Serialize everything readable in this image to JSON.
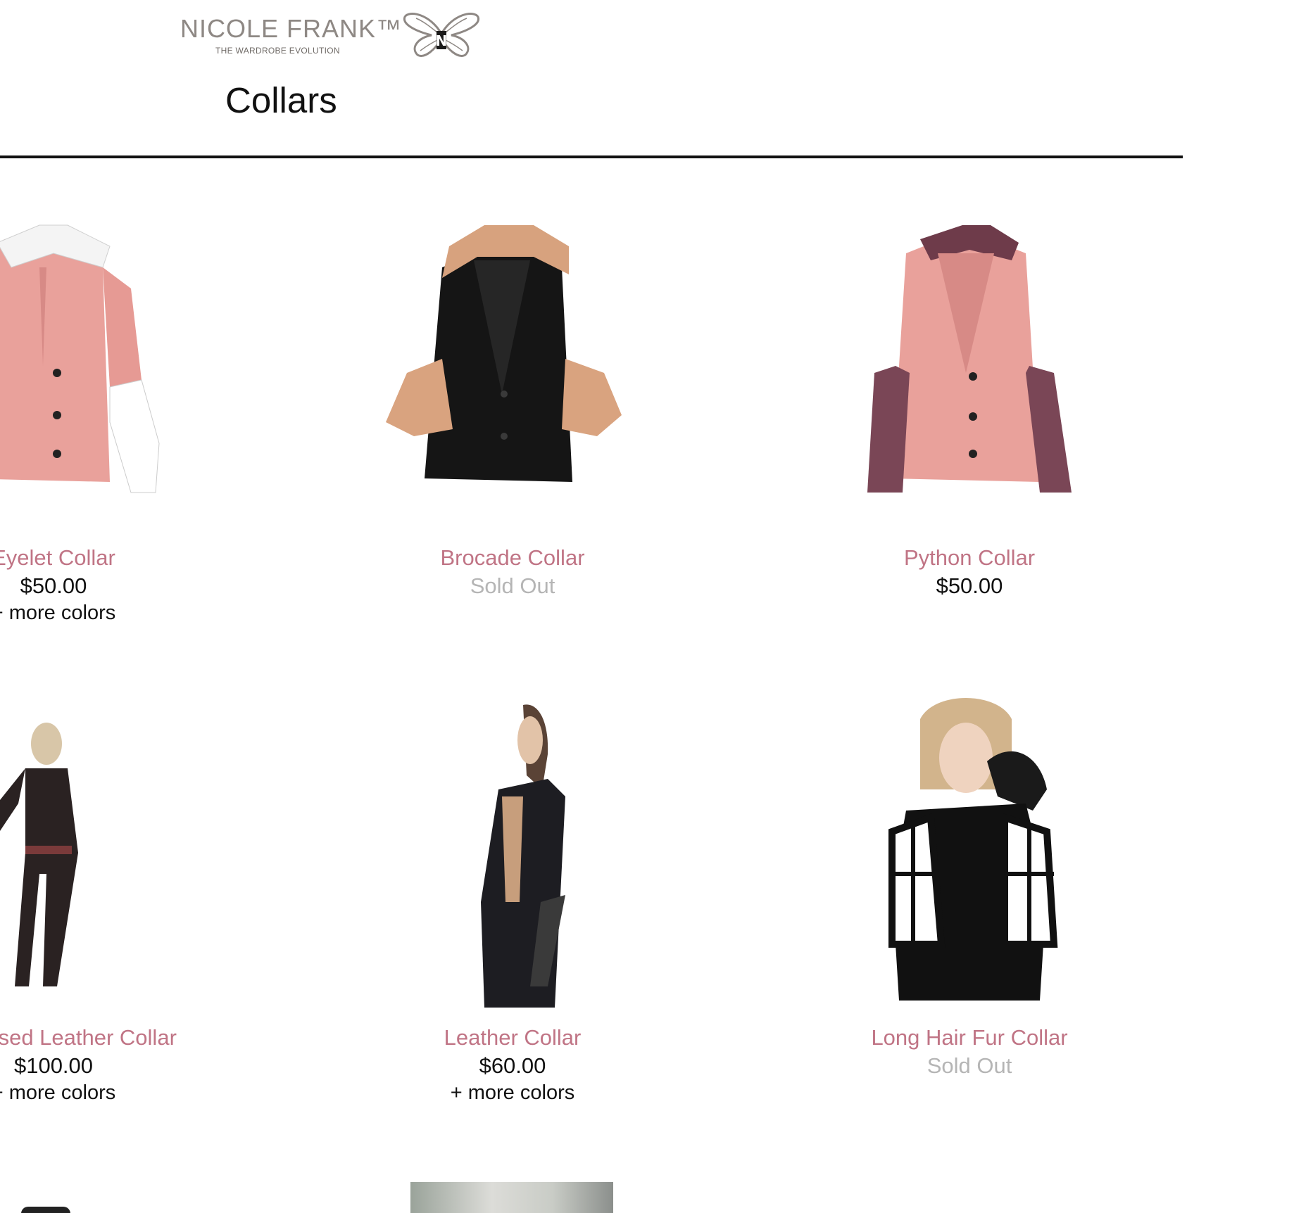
{
  "brand": {
    "name": "NICOLE FRANK™",
    "tagline": "THE WARDROBE EVOLUTION"
  },
  "page": {
    "title": "Collars"
  },
  "products": [
    {
      "name": "Eyelet Collar",
      "price": "$50.00",
      "more": "+ more colors",
      "sold_out": false
    },
    {
      "name": "Brocade Collar",
      "price": "Sold Out",
      "more": "",
      "sold_out": true
    },
    {
      "name": "Python Collar",
      "price": "$50.00",
      "more": "",
      "sold_out": false
    },
    {
      "name": "Embossed Leather Collar",
      "price": "$100.00",
      "more": "+ more colors",
      "sold_out": false
    },
    {
      "name": "Leather Collar",
      "price": "$60.00",
      "more": "+ more colors",
      "sold_out": false
    },
    {
      "name": "Long Hair Fur Collar",
      "price": "Sold Out",
      "more": "",
      "sold_out": true
    }
  ],
  "colors": {
    "name": "#c07485",
    "price": "#111111",
    "sold_out": "#b5b5b5",
    "blazer_pink": "#e9a19b",
    "blazer_black": "#151515"
  }
}
